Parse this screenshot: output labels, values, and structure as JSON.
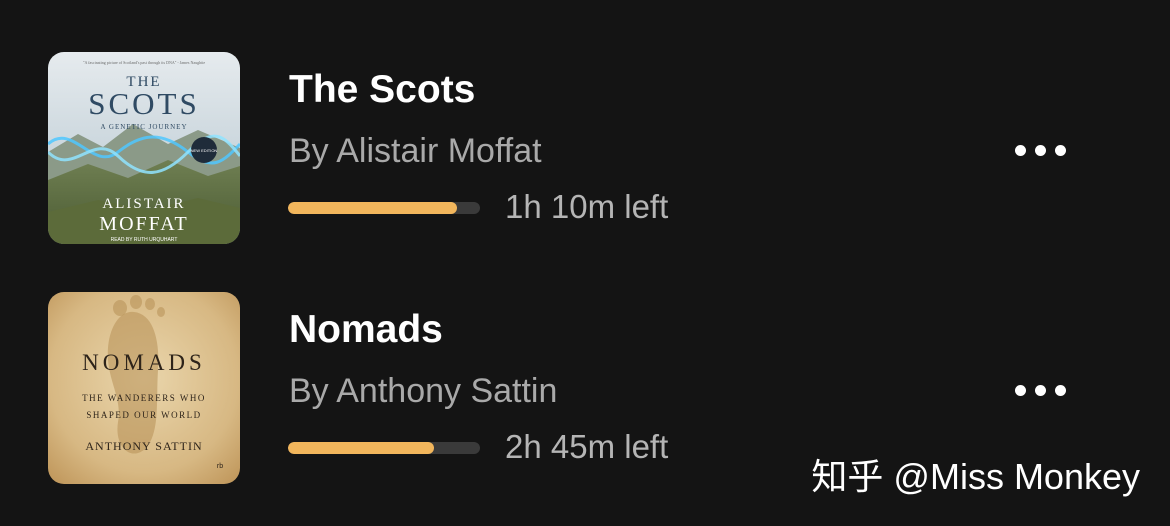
{
  "books": [
    {
      "title": "The Scots",
      "author": "By Alistair Moffat",
      "time_left": "1h 10m left",
      "progress": 0.88,
      "cover": {
        "quote": "\"A fascinating picture of Scotland's past through its DNA\" - James Naughtie",
        "line1": "THE",
        "line2": "SCOTS",
        "subtitle": "A GENETIC JOURNEY",
        "badge": "NEW EDITION",
        "author_first": "ALISTAIR",
        "author_last": "MOFFAT",
        "narrator": "READ BY RUTH URQUHART"
      }
    },
    {
      "title": "Nomads",
      "author": "By Anthony Sattin",
      "time_left": "2h 45m left",
      "progress": 0.76,
      "cover": {
        "title": "NOMADS",
        "subtitle_line1": "THE WANDERERS WHO",
        "subtitle_line2": "SHAPED OUR WORLD",
        "author": "ANTHONY SATTIN",
        "publisher": "rb"
      }
    }
  ],
  "watermark": "知乎 @Miss Monkey",
  "colors": {
    "background": "#141414",
    "progress_fill": "#f2b65c",
    "progress_track": "#3a3a3a",
    "author_text": "#a9a9a9"
  }
}
